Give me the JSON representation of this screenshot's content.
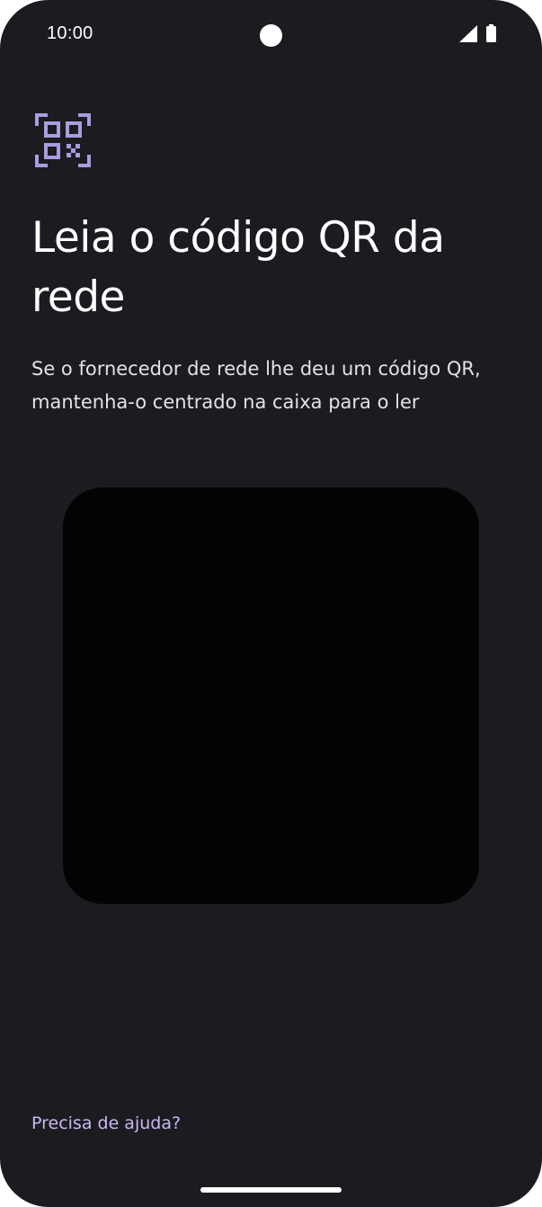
{
  "status_bar": {
    "time": "10:00",
    "icons": [
      "camera-cutout",
      "cellular-signal-icon",
      "battery-icon"
    ]
  },
  "header": {
    "icon": "qr-code-scanner-icon",
    "title": "Leia o código QR da rede",
    "subtitle": "Se o fornecedor de rede lhe deu um código QR, mantenha-o centrado na caixa para o ler"
  },
  "scanner": {
    "icon": "camera-viewfinder"
  },
  "footer": {
    "help_link": "Precisa de ajuda?"
  },
  "colors": {
    "background": "#1c1b20",
    "accent": "#c9b9f3",
    "scanner_background": "#030303",
    "text_primary": "#ffffff"
  }
}
